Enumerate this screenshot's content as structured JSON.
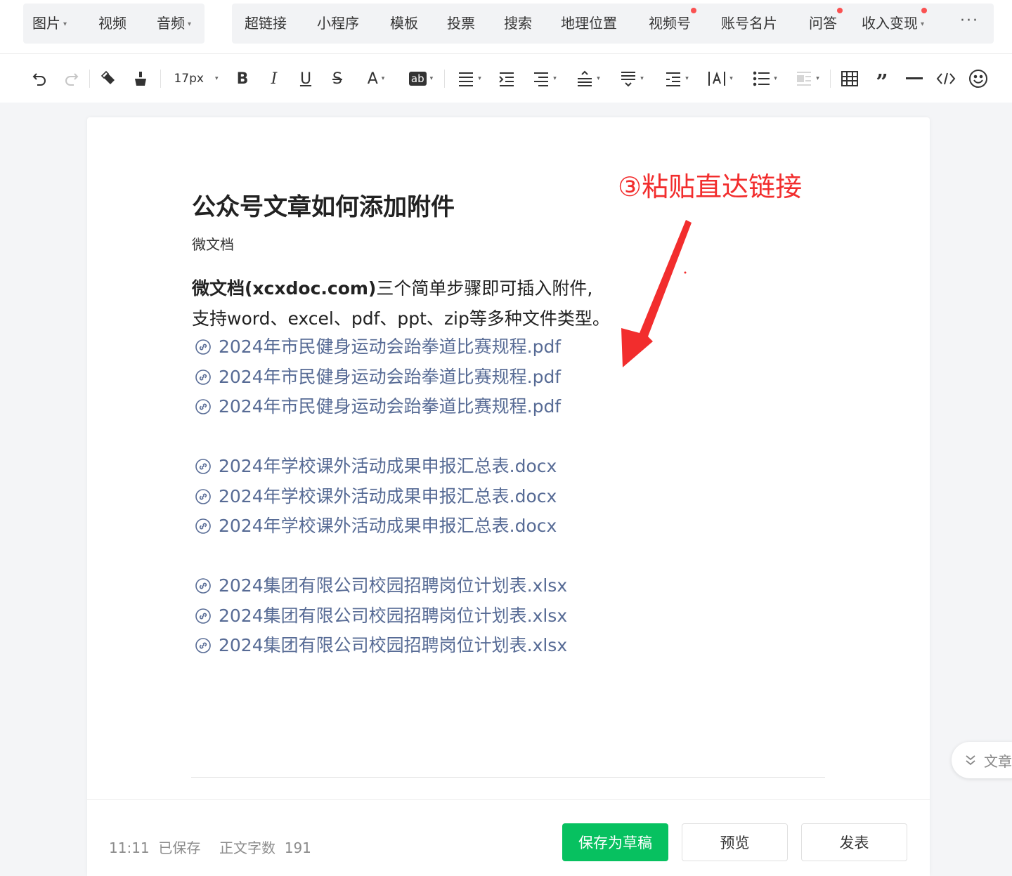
{
  "insert_menu": {
    "group1": [
      {
        "label": "图片",
        "caret": true
      },
      {
        "label": "视频",
        "caret": false
      },
      {
        "label": "音频",
        "caret": true
      }
    ],
    "group2": [
      {
        "label": "超链接",
        "caret": false,
        "dot": false
      },
      {
        "label": "小程序",
        "caret": false,
        "dot": false
      },
      {
        "label": "模板",
        "caret": false,
        "dot": false
      },
      {
        "label": "投票",
        "caret": false,
        "dot": false
      },
      {
        "label": "搜索",
        "caret": false,
        "dot": false
      },
      {
        "label": "地理位置",
        "caret": false,
        "dot": false
      },
      {
        "label": "视频号",
        "caret": false,
        "dot": true
      },
      {
        "label": "账号名片",
        "caret": false,
        "dot": false
      },
      {
        "label": "问答",
        "caret": false,
        "dot": true
      },
      {
        "label": "收入变现",
        "caret": true,
        "dot": true
      }
    ],
    "more": "···"
  },
  "toolbar": {
    "font_size": "17px",
    "tools": [
      "undo-icon",
      "redo-icon",
      "format-painter-icon",
      "clear-format-icon",
      "bold-icon",
      "italic-icon",
      "underline-icon",
      "strikethrough-icon",
      "font-color-icon",
      "highlight-icon",
      "align-icon",
      "indent-icon",
      "paragraph-indent-icon",
      "line-spacing-icon",
      "paragraph-spacing-icon",
      "two-end-indent-icon",
      "letter-spacing-icon",
      "list-icon",
      "float-icon",
      "table-icon",
      "quote-icon",
      "divider-icon",
      "code-icon",
      "emoji-icon"
    ],
    "highlight_label": "ab"
  },
  "article": {
    "title": "公众号文章如何添加附件",
    "author": "微文档",
    "intro_brand": "微文档(xcxdoc.com)",
    "intro_line1_rest": "三个简单步骤即可插入附件,",
    "intro_line2": "支持word、excel、pdf、ppt、zip等多种文件类型。",
    "links": [
      "2024年市民健身运动会跆拳道比赛规程.pdf",
      "2024年市民健身运动会跆拳道比赛规程.pdf",
      "2024年市民健身运动会跆拳道比赛规程.pdf",
      "",
      "2024年学校课外活动成果申报汇总表.docx",
      "2024年学校课外活动成果申报汇总表.docx",
      "2024年学校课外活动成果申报汇总表.docx",
      "",
      "2024集团有限公司校园招聘岗位计划表.xlsx",
      "2024集团有限公司校园招聘岗位计划表.xlsx",
      "2024集团有限公司校园招聘岗位计划表.xlsx"
    ],
    "annotation": "③粘贴直达链接"
  },
  "footer": {
    "saved_time": "11:11",
    "saved_label": "已保存",
    "word_count_label": "正文字数",
    "word_count": "191",
    "save_draft": "保存为草稿",
    "preview": "预览",
    "publish": "发表"
  },
  "side_tab": {
    "label": "文章"
  },
  "colors": {
    "link": "#576b95",
    "primary": "#07c160",
    "annotation": "#f22d2d",
    "dot": "#fa5151"
  }
}
